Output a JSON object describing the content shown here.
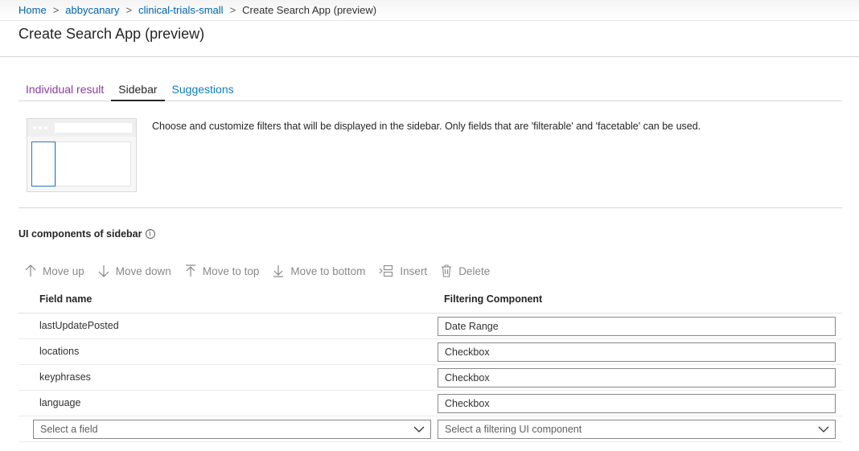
{
  "breadcrumb": {
    "items": [
      "Home",
      "abbycanary",
      "clinical-trials-small"
    ],
    "current": "Create Search App (preview)",
    "separator": ">"
  },
  "page": {
    "title": "Create Search App (preview)"
  },
  "tabs": [
    {
      "label": "Individual result",
      "state": "visited"
    },
    {
      "label": "Sidebar",
      "state": "active"
    },
    {
      "label": "Suggestions",
      "state": "link"
    }
  ],
  "description": "Choose and customize filters that will be displayed in the sidebar. Only fields that are 'filterable' and 'facetable' can be used.",
  "section": {
    "heading": "UI components of sidebar",
    "info_icon": "info-icon"
  },
  "toolbar": {
    "move_up": "Move up",
    "move_down": "Move down",
    "move_to_top": "Move to top",
    "move_to_bottom": "Move to bottom",
    "insert": "Insert",
    "delete": "Delete"
  },
  "table": {
    "headers": {
      "field": "Field name",
      "component": "Filtering Component"
    },
    "rows": [
      {
        "field": "lastUpdatePosted",
        "component": "Date Range"
      },
      {
        "field": "locations",
        "component": "Checkbox"
      },
      {
        "field": "keyphrases",
        "component": "Checkbox"
      },
      {
        "field": "language",
        "component": "Checkbox"
      }
    ],
    "new_row": {
      "field_placeholder": "Select a field",
      "component_placeholder": "Select a filtering UI component"
    }
  },
  "colors": {
    "link": "#0062ad",
    "visited_tab": "#8a3c9e",
    "active_tab": "#252525",
    "disabled_tool": "#8a8886",
    "preview_accent": "#2b78c2"
  }
}
